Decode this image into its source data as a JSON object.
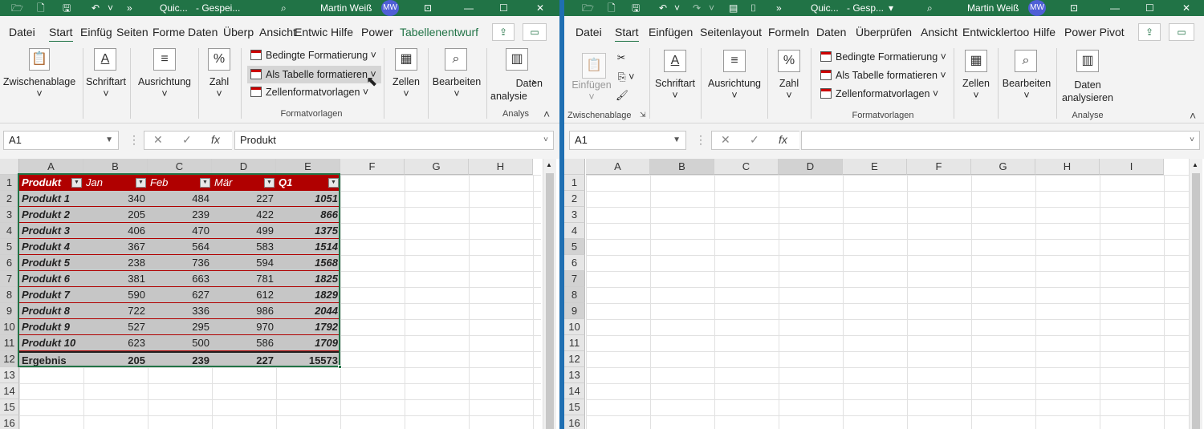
{
  "left": {
    "titlebar": {
      "doc": "Quic...",
      "status": "- Gespei...",
      "user": "Martin Weiß",
      "initials": "MW"
    },
    "tabs": [
      "Datei",
      "Start",
      "Einfüg",
      "Seiten",
      "Forme",
      "Daten",
      "Überp",
      "Ansicht",
      "Entwic",
      "Hilfe",
      "Power",
      "Tabellenentwurf"
    ],
    "ribbon": {
      "clipboard": "Zwischenablage",
      "font": "Schriftart",
      "align": "Ausrichtung",
      "number": "Zahl",
      "cond": "Bedingte Formatierung",
      "astable": "Als Tabelle formatieren",
      "cellstyles": "Zellenformatvorlagen",
      "group_styles": "Formatvorlagen",
      "cells": "Zellen",
      "edit": "Bearbeiten",
      "analyze1": "Daten",
      "analyze2": "analysie",
      "group_analyze": "Analys"
    },
    "namebox": "A1",
    "formula": "Produkt",
    "columns": [
      "A",
      "B",
      "C",
      "D",
      "E",
      "F",
      "G",
      "H"
    ],
    "rows": [
      "1",
      "2",
      "3",
      "4",
      "5",
      "6",
      "7",
      "8",
      "9",
      "10",
      "11",
      "12",
      "13",
      "14",
      "15",
      "16"
    ],
    "table": {
      "headers": [
        "Produkt",
        "Jan",
        "Feb",
        "Mär",
        "Q1"
      ],
      "data": [
        [
          "Produkt 1",
          "340",
          "484",
          "227",
          "1051"
        ],
        [
          "Produkt 2",
          "205",
          "239",
          "422",
          "866"
        ],
        [
          "Produkt 3",
          "406",
          "470",
          "499",
          "1375"
        ],
        [
          "Produkt 4",
          "367",
          "564",
          "583",
          "1514"
        ],
        [
          "Produkt 5",
          "238",
          "736",
          "594",
          "1568"
        ],
        [
          "Produkt 6",
          "381",
          "663",
          "781",
          "1825"
        ],
        [
          "Produkt 7",
          "590",
          "627",
          "612",
          "1829"
        ],
        [
          "Produkt 8",
          "722",
          "336",
          "986",
          "2044"
        ],
        [
          "Produkt 9",
          "527",
          "295",
          "970",
          "1792"
        ],
        [
          "Produkt 10",
          "623",
          "500",
          "586",
          "1709"
        ]
      ],
      "total": [
        "Ergebnis",
        "205",
        "239",
        "227",
        "15573"
      ]
    }
  },
  "right": {
    "titlebar": {
      "doc": "Quic...",
      "status": "- Gesp...",
      "user": "Martin Weiß",
      "initials": "MW"
    },
    "tabs": [
      "Datei",
      "Start",
      "Einfügen",
      "Seitenlayout",
      "Formeln",
      "Daten",
      "Überprüfen",
      "Ansicht",
      "Entwicklertoo",
      "Hilfe",
      "Power Pivot"
    ],
    "ribbon": {
      "paste": "Einfügen",
      "group_clip": "Zwischenablage",
      "font": "Schriftart",
      "align": "Ausrichtung",
      "number": "Zahl",
      "cond": "Bedingte Formatierung",
      "astable": "Als Tabelle formatieren",
      "cellstyles": "Zellenformatvorlagen",
      "group_styles": "Formatvorlagen",
      "cells": "Zellen",
      "edit": "Bearbeiten",
      "analyze1": "Daten",
      "analyze2": "analysieren",
      "group_analyze": "Analyse"
    },
    "namebox": "A1",
    "formula": "",
    "columns": [
      "A",
      "B",
      "C",
      "D",
      "E",
      "F",
      "G",
      "H",
      "I"
    ],
    "rows": [
      "1",
      "2",
      "3",
      "4",
      "5",
      "6",
      "7",
      "8",
      "9",
      "10",
      "11",
      "12",
      "13",
      "14",
      "15",
      "16"
    ]
  },
  "colors": {
    "excel_green": "#217346",
    "table_header": "#b00000",
    "table_body": "#c6c6c6"
  }
}
